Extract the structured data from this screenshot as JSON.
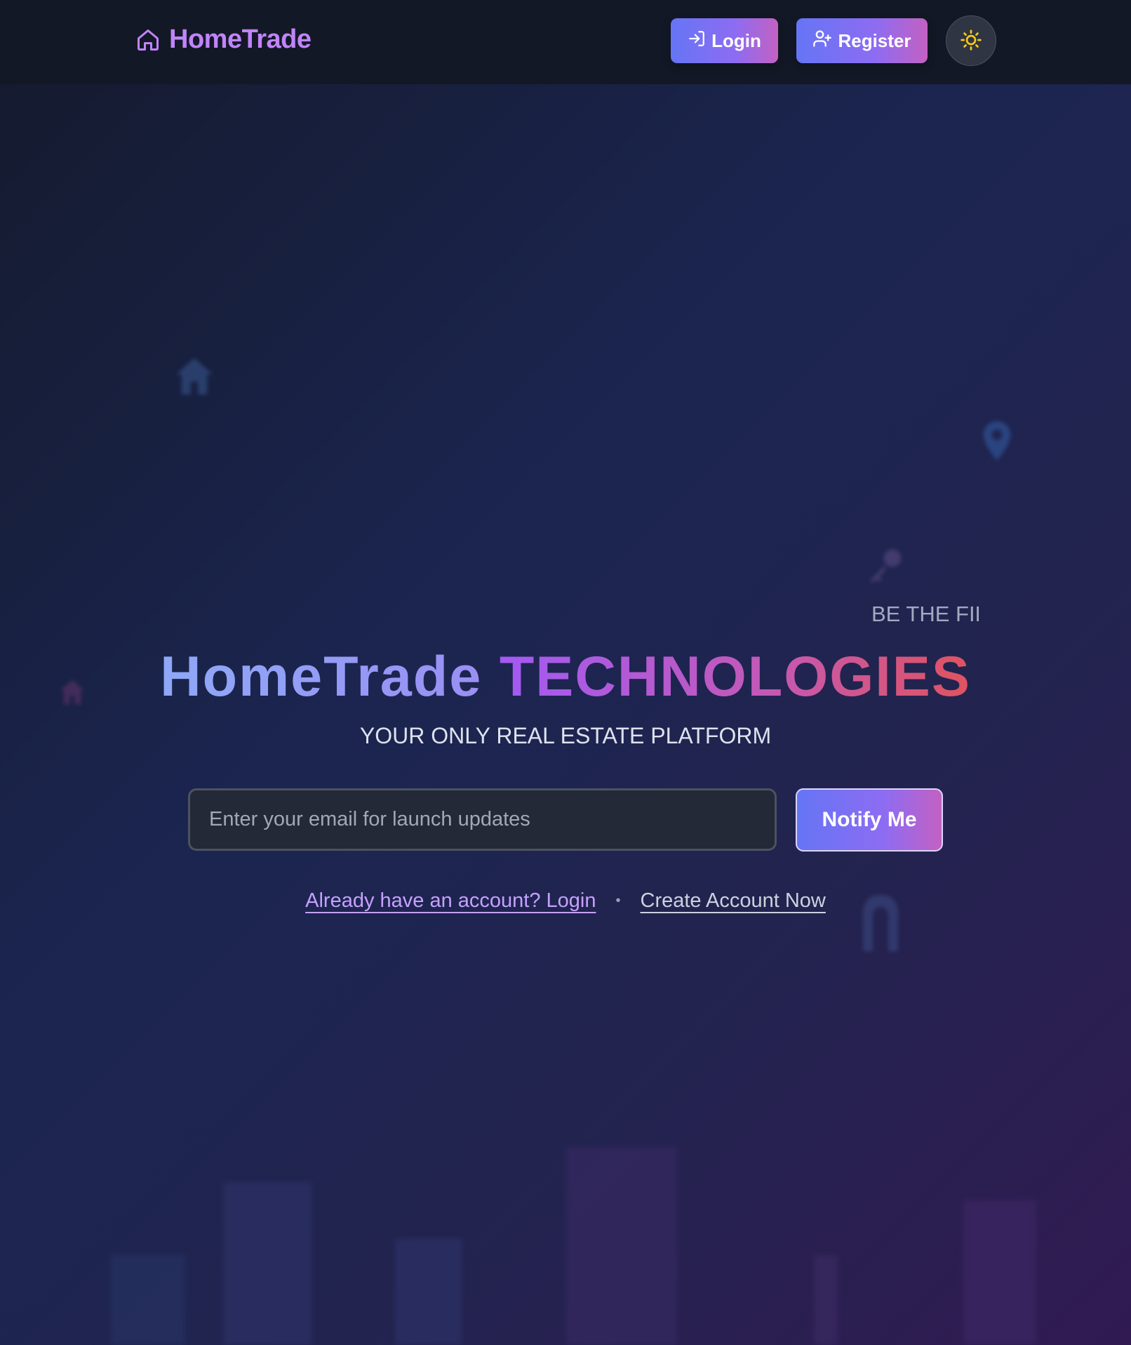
{
  "navbar": {
    "brand": "HomeTrade",
    "brand_icon": "home-icon",
    "login_label": "Login",
    "login_icon": "login-arrow-icon",
    "register_label": "Register",
    "register_icon": "user-plus-icon",
    "theme_icon": "sun-icon"
  },
  "hero": {
    "ticker_text": "BE THE FIRST",
    "title_part1": "HomeTrade",
    "title_part2": "TECHNOLOGIES",
    "subtitle": "YOUR ONLY REAL ESTATE PLATFORM",
    "email_placeholder": "Enter your email for launch updates",
    "email_value": "",
    "notify_label": "Notify Me",
    "login_link": "Already have an account? Login",
    "separator": "•",
    "create_link": "Create Account Now"
  },
  "decorations": {
    "icons": [
      "house-icon",
      "map-pin-icon",
      "key-icon",
      "house-icon",
      "door-icon"
    ]
  },
  "colors": {
    "navbar_bg": "#131826",
    "brand": "#c084fc",
    "button_gradient_start": "#6575f5",
    "button_gradient_end": "#c361c2",
    "theme_icon": "#facc15",
    "login_link": "#c6a0ff"
  }
}
